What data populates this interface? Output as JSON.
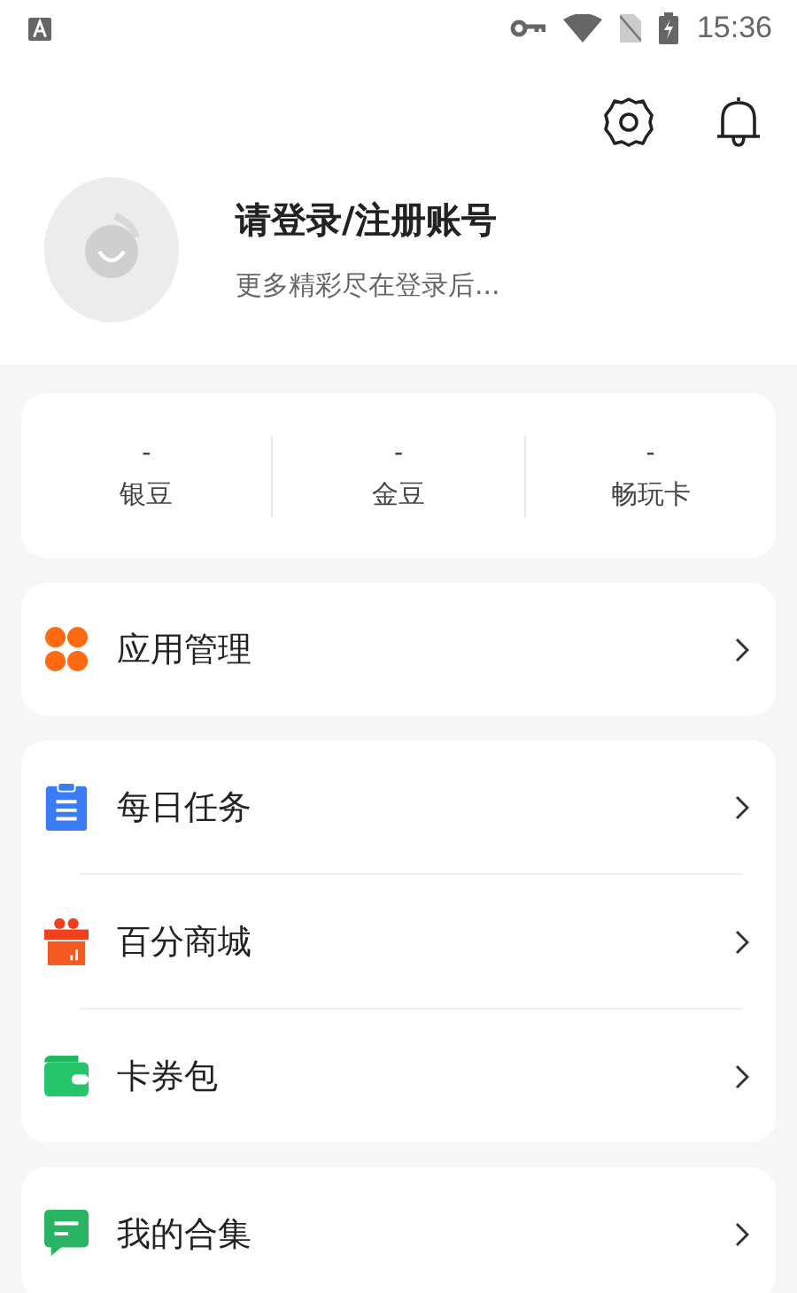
{
  "status_bar": {
    "time": "15:36"
  },
  "profile": {
    "title": "请登录/注册账号",
    "subtitle": "更多精彩尽在登录后..."
  },
  "stats": [
    {
      "value": "-",
      "label": "银豆"
    },
    {
      "value": "-",
      "label": "金豆"
    },
    {
      "value": "-",
      "label": "畅玩卡"
    }
  ],
  "menu_groups": [
    {
      "items": [
        {
          "kind": "apps",
          "label": "应用管理"
        }
      ]
    },
    {
      "items": [
        {
          "kind": "tasks",
          "label": "每日任务"
        },
        {
          "kind": "gift",
          "label": "百分商城"
        },
        {
          "kind": "wallet",
          "label": "卡券包"
        }
      ]
    },
    {
      "items": [
        {
          "kind": "chat",
          "label": "我的合集"
        }
      ]
    }
  ]
}
